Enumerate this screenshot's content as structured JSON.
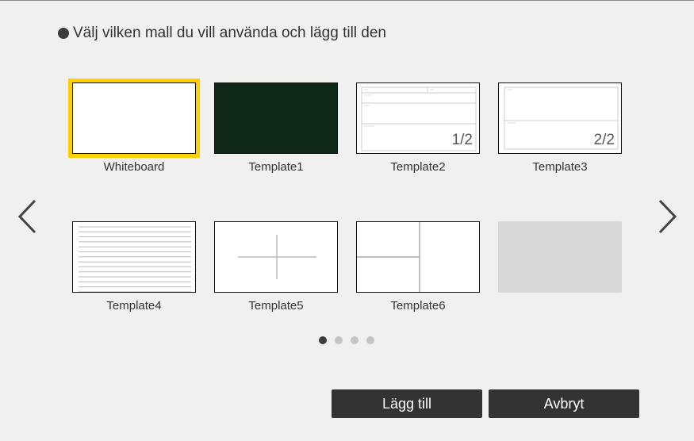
{
  "instruction": "Välj vilken mall du vill använda och lägg till den",
  "templates": [
    {
      "label": "Whiteboard",
      "style": "blank",
      "selected": true
    },
    {
      "label": "Template1",
      "style": "dark",
      "color": "#0f2716"
    },
    {
      "label": "Template2",
      "style": "form",
      "page": "1/2"
    },
    {
      "label": "Template3",
      "style": "form2",
      "page": "2/2"
    },
    {
      "label": "Template4",
      "style": "lined"
    },
    {
      "label": "Template5",
      "style": "cross"
    },
    {
      "label": "Template6",
      "style": "split"
    },
    {
      "label": "",
      "style": "empty"
    }
  ],
  "pager": {
    "pages": 4,
    "current": 1
  },
  "buttons": {
    "add": "Lägg till",
    "cancel": "Avbryt"
  },
  "colors": {
    "selection": "#ffd000",
    "button_bg": "#333333"
  }
}
